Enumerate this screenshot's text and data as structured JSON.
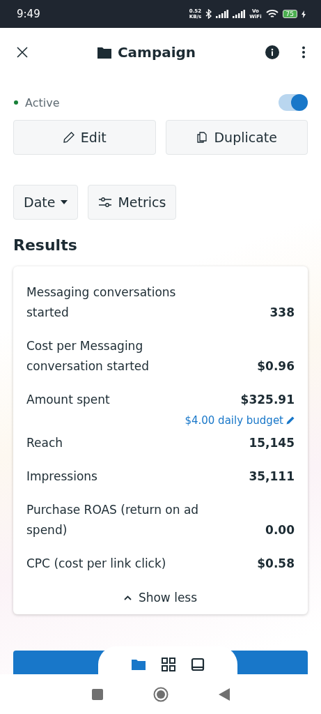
{
  "status_bar": {
    "time": "9:49",
    "speed": "0.52",
    "speed_unit": "KB/s",
    "network": "Vo",
    "network_sub": "WiFi",
    "battery": "75"
  },
  "header": {
    "title": "Campaign"
  },
  "status": {
    "label": "Active",
    "color": "#188038",
    "on": true
  },
  "actions": [
    "Edit",
    "Duplicate"
  ],
  "filters": [
    {
      "kind": "dropdown",
      "label": "Date"
    },
    {
      "kind": "settings",
      "label": "Metrics"
    }
  ],
  "results": {
    "title": "Results",
    "rows": [
      {
        "label": "Messaging conversations started",
        "value": "338"
      },
      {
        "label": "Cost per Messaging conversation started",
        "value": "$0.96"
      },
      {
        "label": "Amount spent",
        "value": "$325.91",
        "link": "$4.00 daily budget"
      },
      {
        "label": "Reach",
        "value": "15,145"
      },
      {
        "label": "Impressions",
        "value": "35,111"
      },
      {
        "label": "Purchase ROAS (return on ad spend)",
        "value": "0.00"
      },
      {
        "label": "CPC (cost per link click)",
        "value": "$0.58"
      }
    ],
    "toggle": "Show less"
  },
  "bottom_tabs": [
    {
      "kind": "folder",
      "selected": true
    },
    {
      "kind": "grid",
      "selected": false
    },
    {
      "kind": "tablet",
      "selected": false
    }
  ]
}
